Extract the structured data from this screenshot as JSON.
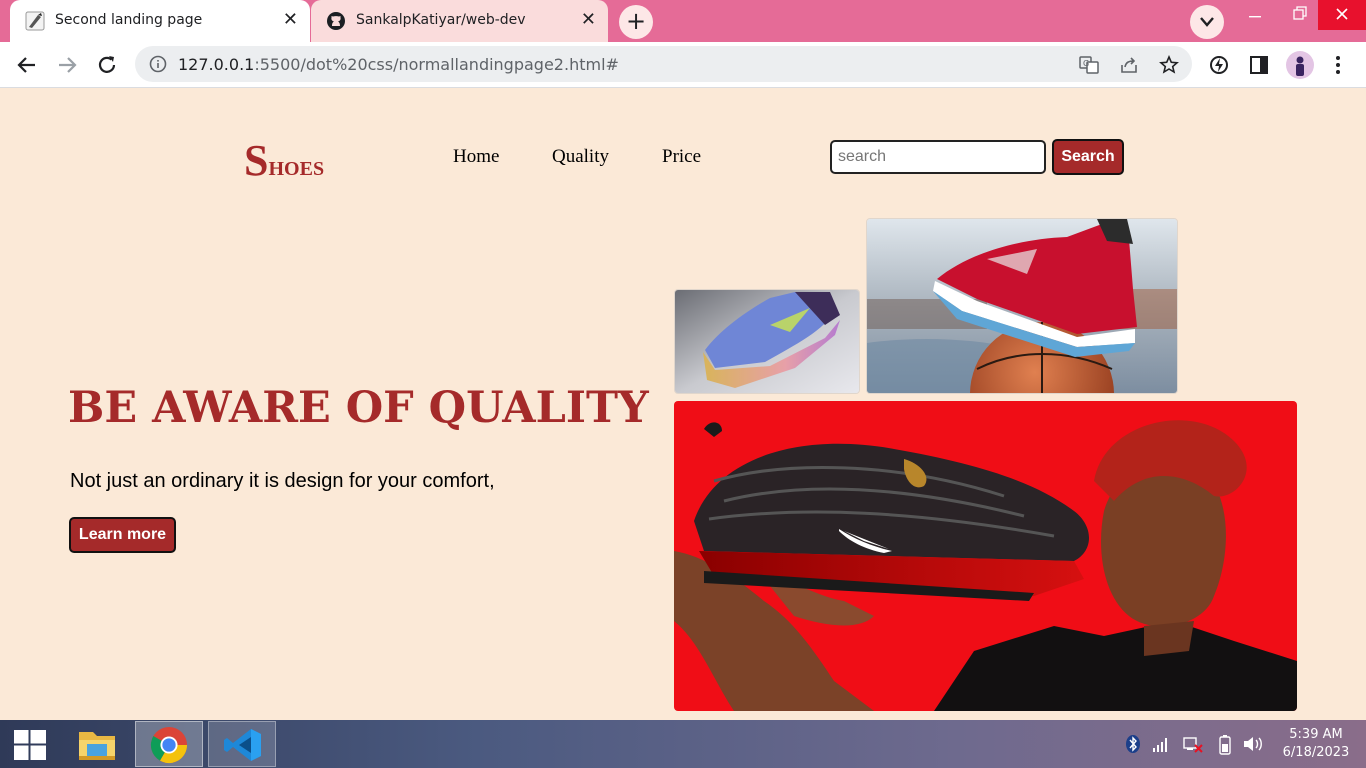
{
  "browser": {
    "tabs": [
      {
        "title": "Second landing page",
        "active": true
      },
      {
        "title": "SankalpKatiyar/web-dev",
        "active": false
      }
    ],
    "new_tab_symbol": "+",
    "close_symbol": "✕",
    "url_host": "127.0.0.1",
    "url_rest": ":5500/dot%20css/normallandingpage2.html#"
  },
  "page": {
    "logo": {
      "initial": "S",
      "rest": "HOES"
    },
    "nav": [
      {
        "label": "Home"
      },
      {
        "label": "Quality"
      },
      {
        "label": "Price"
      }
    ],
    "search": {
      "placeholder": "search",
      "button_label": "Search"
    },
    "hero": {
      "title": "Be aware of quality",
      "subtitle": "Not just an ordinary it is design for your comfort,",
      "cta_label": "Learn more"
    },
    "images": [
      {
        "icon": "blue-sneaker-photo"
      },
      {
        "icon": "red-sneaker-on-basketball-photo"
      },
      {
        "icon": "man-holding-black-red-sneaker-photo"
      }
    ]
  },
  "taskbar": {
    "time": "5:39 AM",
    "date": "6/18/2023"
  },
  "colors": {
    "page_bg": "#fbe9d7",
    "accent": "#a52a2a",
    "tabbar": "#e56b97"
  }
}
